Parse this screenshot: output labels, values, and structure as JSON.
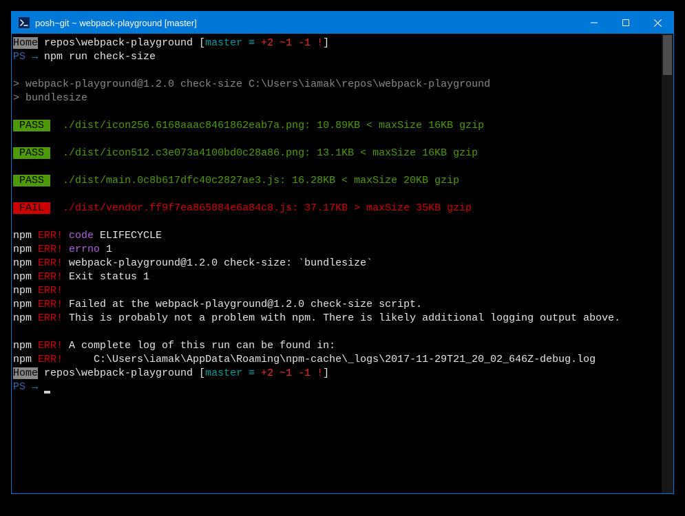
{
  "window": {
    "title": "posh~git ~ webpack-playground [master]"
  },
  "prompt1": {
    "home": "Home",
    "path": " repos\\webpack-playground ",
    "bl": "[",
    "branch": "master",
    "eq": " ≡ ",
    "p": "+2",
    "m": " ~1 ",
    "d": "-1 !",
    "br": "]"
  },
  "ps1": {
    "ps": "PS",
    "arrow": " → ",
    "cmd": "npm run check-size"
  },
  "blank": " ",
  "npm_hdr1": "> webpack-playground@1.2.0 check-size C:\\Users\\iamak\\repos\\webpack-playground",
  "npm_hdr2": "> bundlesize",
  "checks": [
    {
      "status": "PASS",
      "text": "  ./dist/icon256.6168aaac8461862eab7a.png: 10.89KB < maxSize 16KB gzip"
    },
    {
      "status": "PASS",
      "text": "  ./dist/icon512.c3e073a4100bd0c28a86.png: 13.1KB < maxSize 16KB gzip"
    },
    {
      "status": "PASS",
      "text": "  ./dist/main.0c8b617dfc40c2827ae3.js: 16.28KB < maxSize 20KB gzip"
    },
    {
      "status": "FAIL",
      "text": "  ./dist/vendor.ff9f7ea865884e6a84c8.js: 37.17KB > maxSize 35KB gzip"
    }
  ],
  "npm": "npm",
  "err": " ERR!",
  "e1a": " code",
  "e1b": " ELIFECYCLE",
  "e2a": " errno",
  "e2b": " 1",
  "e3": " webpack-playground@1.2.0 check-size: `bundlesize`",
  "e4": " Exit status 1",
  "e5": "",
  "e6": " Failed at the webpack-playground@1.2.0 check-size script.",
  "e7": " This is probably not a problem with npm. There is likely additional logging output above.",
  "e8": " A complete log of this run can be found in:",
  "e9": "     C:\\Users\\iamak\\AppData\\Roaming\\npm-cache\\_logs\\2017-11-29T21_20_02_646Z-debug.log",
  "ps2": {
    "ps": "PS",
    "arrow": " → "
  }
}
